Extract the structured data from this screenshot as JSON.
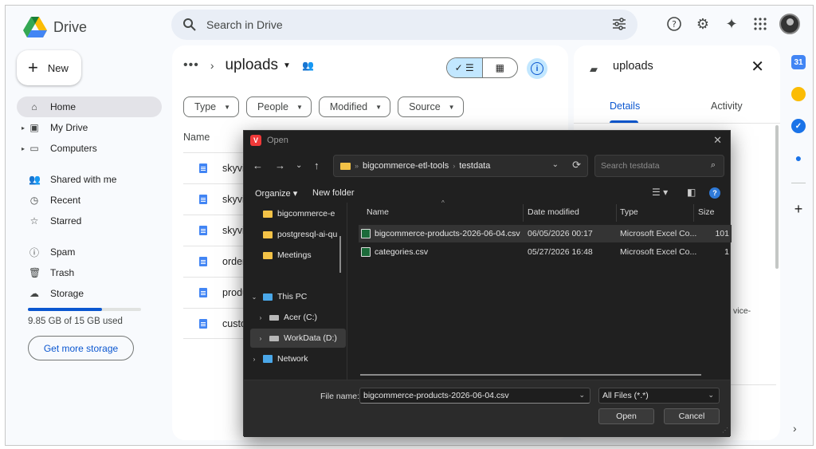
{
  "app": {
    "name": "Drive"
  },
  "search": {
    "placeholder": "Search in Drive"
  },
  "sidebar": {
    "new_label": "New",
    "items": [
      {
        "label": "Home",
        "icon": "home-icon",
        "active": true
      },
      {
        "label": "My Drive",
        "icon": "drive-icon"
      },
      {
        "label": "Computers",
        "icon": "computer-icon"
      },
      {
        "label": "Shared with me",
        "icon": "people-icon"
      },
      {
        "label": "Recent",
        "icon": "clock-icon"
      },
      {
        "label": "Starred",
        "icon": "star-icon"
      },
      {
        "label": "Spam",
        "icon": "spam-icon"
      },
      {
        "label": "Trash",
        "icon": "trash-icon"
      },
      {
        "label": "Storage",
        "icon": "cloud-icon"
      }
    ],
    "storage": {
      "used_text": "9.85 GB of 15 GB used",
      "fraction": 0.657,
      "button": "Get more storage"
    }
  },
  "main": {
    "folder_title": "uploads",
    "filters": [
      "Type",
      "People",
      "Modified",
      "Source"
    ],
    "list_header": "Name",
    "files": [
      "skyvi",
      "skyvi",
      "skyvi",
      "order",
      "produ",
      "custo"
    ]
  },
  "details": {
    "title": "uploads",
    "tabs": [
      "Details",
      "Activity"
    ],
    "truncated_text": "vice-"
  },
  "dialog": {
    "title": "Open",
    "path": [
      "bigcommerce-etl-tools",
      "testdata"
    ],
    "search_placeholder": "Search testdata",
    "toolbar": {
      "organize": "Organize",
      "new_folder": "New folder"
    },
    "nav_items": [
      {
        "label": "bigcommerce-e",
        "kind": "folder"
      },
      {
        "label": "postgresql-ai-qu",
        "kind": "folder"
      },
      {
        "label": "Meetings",
        "kind": "folder"
      },
      {
        "label": "This PC",
        "kind": "pc"
      },
      {
        "label": "Acer (C:)",
        "kind": "drive"
      },
      {
        "label": "WorkData (D:)",
        "kind": "drive"
      },
      {
        "label": "Network",
        "kind": "network"
      }
    ],
    "columns": [
      "Name",
      "Date modified",
      "Type",
      "Size"
    ],
    "files": [
      {
        "name": "bigcommerce-products-2026-06-04.csv",
        "date": "06/05/2026 00:17",
        "type": "Microsoft Excel Co...",
        "size": "101"
      },
      {
        "name": "categories.csv",
        "date": "05/27/2026 16:48",
        "type": "Microsoft Excel Co...",
        "size": "1"
      }
    ],
    "file_name_label": "File name:",
    "file_name_value": "bigcommerce-products-2026-06-04.csv",
    "file_type": "All Files (*.*)",
    "open_button": "Open",
    "cancel_button": "Cancel"
  },
  "colors": {
    "accent": "#0b57d0",
    "selected": "#c2e7ff",
    "dialog_bg": "#202020"
  }
}
